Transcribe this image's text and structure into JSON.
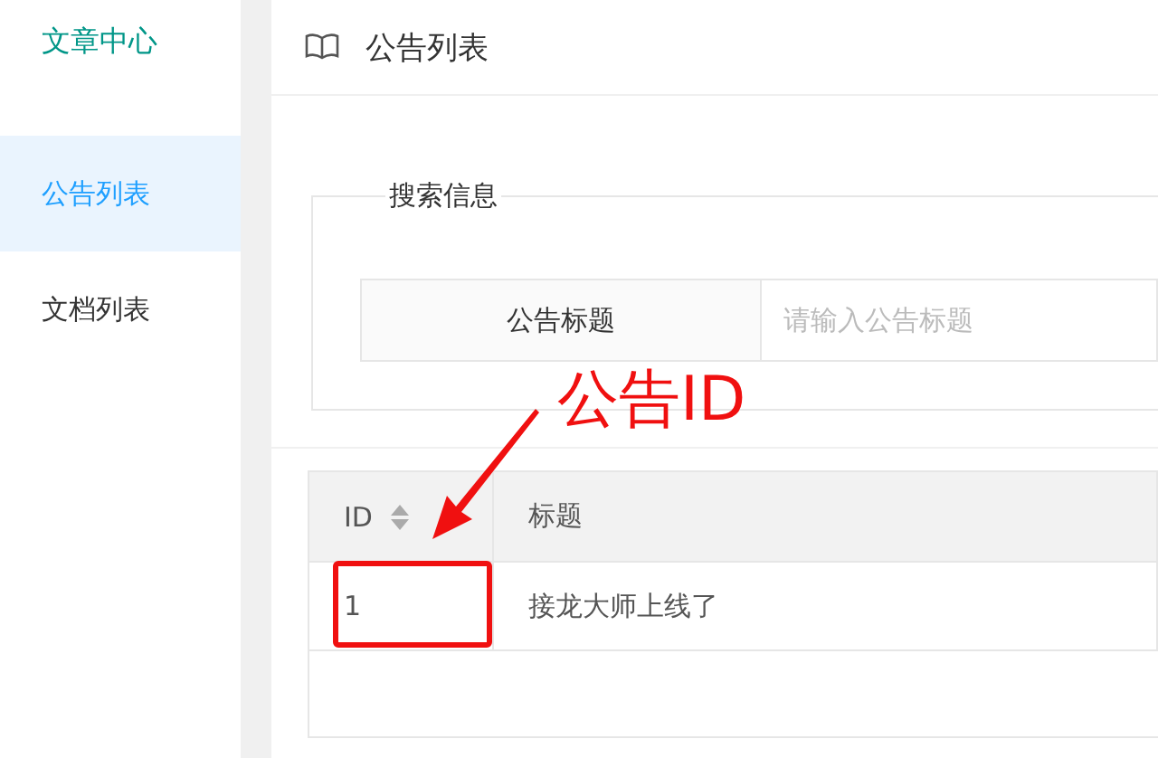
{
  "sidebar": {
    "title": "文章中心",
    "items": [
      {
        "label": "公告列表",
        "selected": true
      },
      {
        "label": "文档列表",
        "selected": false
      }
    ]
  },
  "header": {
    "title": "公告列表"
  },
  "search": {
    "legend": "搜索信息",
    "field_label": "公告标题",
    "placeholder": "请输入公告标题"
  },
  "table": {
    "columns": [
      {
        "label": "ID",
        "sortable": true
      },
      {
        "label": "标题",
        "sortable": false
      }
    ],
    "rows": [
      [
        "1",
        "接龙大师上线了"
      ]
    ]
  },
  "annotation": {
    "label": "公告ID"
  }
}
